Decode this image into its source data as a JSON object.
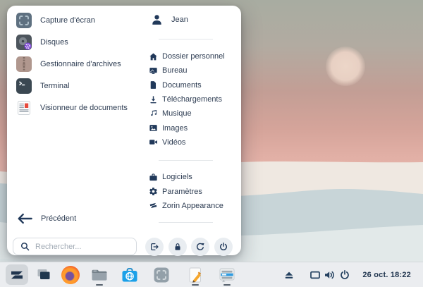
{
  "colors": {
    "accent_navy": "#21395a",
    "menu_bg": "#ffffff",
    "taskbar_bg": "#ebedf0",
    "software_blue": "#1ba0e8",
    "disks_badge_purple": "#7b42d6",
    "archive_tan": "#b0978e",
    "sky_pink": "#e2b0a6"
  },
  "menu": {
    "apps": [
      {
        "label": "Capture d'écran",
        "icon": "screenshot-app-icon"
      },
      {
        "label": "Disques",
        "icon": "disks-app-icon"
      },
      {
        "label": "Gestionnaire d'archives",
        "icon": "archive-manager-app-icon"
      },
      {
        "label": "Terminal",
        "icon": "terminal-app-icon"
      },
      {
        "label": "Visionneur de documents",
        "icon": "document-viewer-app-icon"
      }
    ],
    "user": {
      "name": "Jean",
      "icon": "user-avatar-icon"
    },
    "places": [
      {
        "label": "Dossier personnel",
        "icon": "home-icon"
      },
      {
        "label": "Bureau",
        "icon": "desktop-icon"
      },
      {
        "label": "Documents",
        "icon": "document-icon"
      },
      {
        "label": "Téléchargements",
        "icon": "download-icon"
      },
      {
        "label": "Musique",
        "icon": "music-note-icon"
      },
      {
        "label": "Images",
        "icon": "image-icon"
      },
      {
        "label": "Vidéos",
        "icon": "video-camera-icon"
      }
    ],
    "system_items": [
      {
        "label": "Logiciels",
        "icon": "briefcase-icon"
      },
      {
        "label": "Paramètres",
        "icon": "gear-icon"
      },
      {
        "label": "Zorin Appearance",
        "icon": "zorin-logo-icon"
      }
    ],
    "back_label": "Précédent",
    "search": {
      "placeholder": "Rechercher..."
    },
    "session_buttons": [
      {
        "name": "logout",
        "icon": "logout-icon"
      },
      {
        "name": "lock",
        "icon": "lock-icon"
      },
      {
        "name": "restart",
        "icon": "restart-icon"
      },
      {
        "name": "power",
        "icon": "power-icon"
      }
    ]
  },
  "taskbar": {
    "launchers": [
      "zorin-menu",
      "task-view",
      "firefox",
      "files",
      "software-store",
      "screenshot-tool",
      "text-editor",
      "list-app"
    ],
    "running": [
      "files",
      "text-editor",
      "list-app"
    ],
    "tray": [
      "eject",
      "display",
      "volume",
      "power"
    ],
    "clock": "26 oct. 18:22"
  }
}
